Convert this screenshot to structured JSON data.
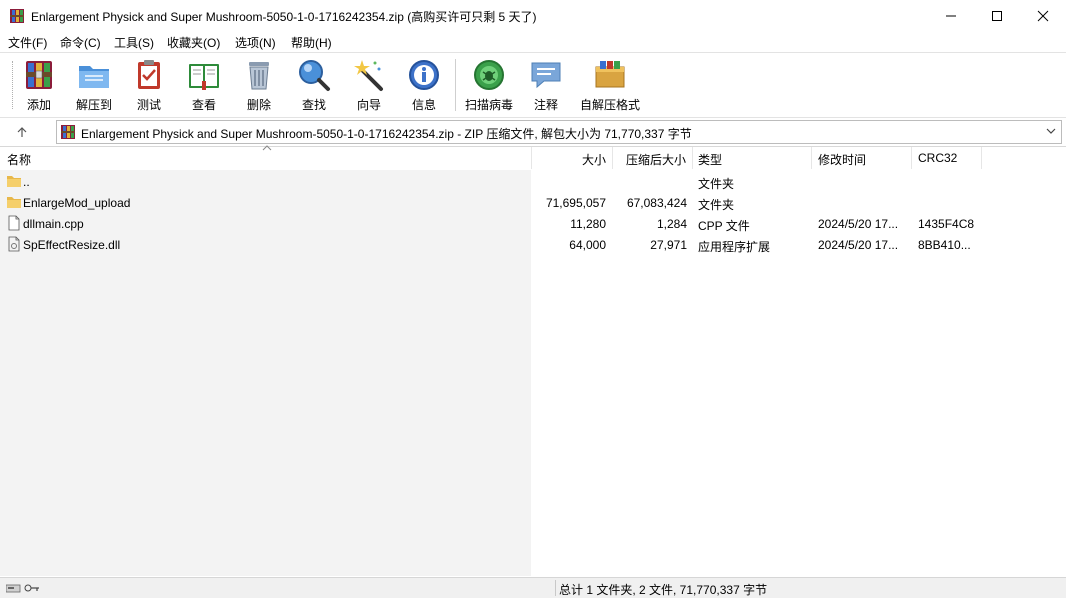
{
  "window": {
    "title": "Enlargement Physick and Super Mushroom-5050-1-0-1716242354.zip (高购买许可只剩 5 天了)"
  },
  "menu": [
    "文件(F)",
    "命令(C)",
    "工具(S)",
    "收藏夹(O)",
    "选项(N)",
    "帮助(H)"
  ],
  "toolbar": {
    "add": "添加",
    "extract": "解压到",
    "test": "测试",
    "view": "查看",
    "delete": "删除",
    "find": "查找",
    "wizard": "向导",
    "info": "信息",
    "scan": "扫描病毒",
    "comment": "注释",
    "sfx": "自解压格式"
  },
  "address": {
    "text": "Enlargement Physick and Super Mushroom-5050-1-0-1716242354.zip - ZIP 压缩文件, 解包大小为 71,770,337 字节"
  },
  "columns": {
    "name": "名称",
    "size": "大小",
    "packed": "压缩后大小",
    "type": "类型",
    "modified": "修改时间",
    "crc": "CRC32"
  },
  "files": [
    {
      "name": "..",
      "size": "",
      "packed": "",
      "type": "文件夹",
      "modified": "",
      "crc": "",
      "icon": "folder-icon"
    },
    {
      "name": "EnlargeMod_upload",
      "size": "71,695,057",
      "packed": "67,083,424",
      "type": "文件夹",
      "modified": "",
      "crc": "",
      "icon": "folder-icon"
    },
    {
      "name": "dllmain.cpp",
      "size": "11,280",
      "packed": "1,284",
      "type": "CPP 文件",
      "modified": "2024/5/20 17...",
      "crc": "1435F4C8",
      "icon": "file-icon"
    },
    {
      "name": "SpEffectResize.dll",
      "size": "64,000",
      "packed": "27,971",
      "type": "应用程序扩展",
      "modified": "2024/5/20 17...",
      "crc": "8BB410...",
      "icon": "dll-icon"
    }
  ],
  "status": {
    "summary": "总计 1 文件夹, 2 文件, 71,770,337 字节"
  }
}
